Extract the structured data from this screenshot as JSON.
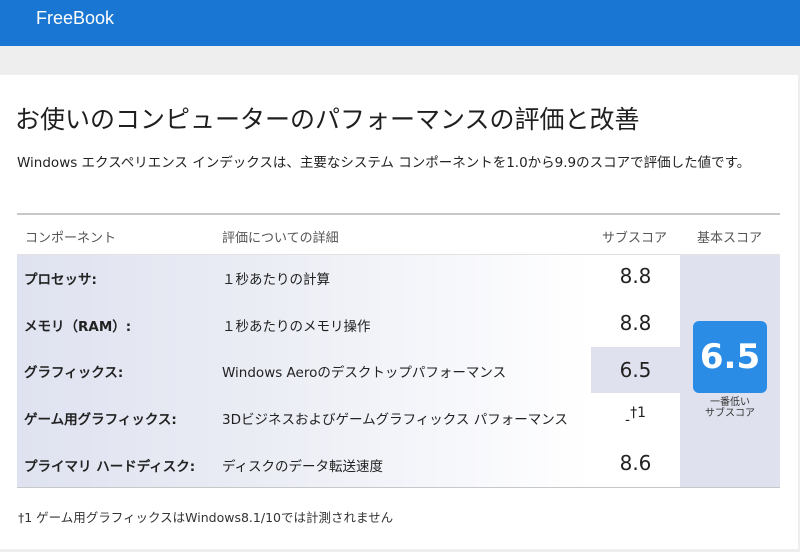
{
  "app": {
    "brand": "FreeBook"
  },
  "page": {
    "title": "お使いのコンピューターのパフォーマンスの評価と改善",
    "description": "Windows エクスペリエンス インデックスは、主要なシステム コンポーネントを1.0から9.9のスコアで評価した値です。"
  },
  "table": {
    "headers": {
      "component": "コンポーネント",
      "detail": "評価についての詳細",
      "subscore": "サブスコア",
      "basescore": "基本スコア"
    },
    "rows": [
      {
        "name": "プロセッサ:",
        "detail": "１秒あたりの計算",
        "score": "8.8"
      },
      {
        "name": "メモリ（RAM）:",
        "detail": "１秒あたりのメモリ操作",
        "score": "8.8"
      },
      {
        "name": "グラフィックス:",
        "detail": "Windows Aeroのデスクトップパフォーマンス",
        "score": "6.5"
      },
      {
        "name": "ゲーム用グラフィックス:",
        "detail": "3Dビジネスおよびゲームグラフィックス パフォーマンス",
        "score": "-",
        "score_note": "†1"
      },
      {
        "name": "プライマリ ハードディスク:",
        "detail": "ディスクのデータ転送速度",
        "score": "8.6"
      }
    ],
    "base": {
      "score": "6.5",
      "label_line1": "一番低い",
      "label_line2": "サブスコア"
    }
  },
  "footnote": "†1 ゲーム用グラフィックスはWindows8.1/10では計測されません"
}
